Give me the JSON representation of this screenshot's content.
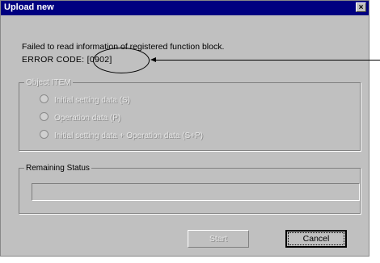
{
  "window": {
    "title": "Upload new",
    "close_glyph": "×"
  },
  "message": {
    "line1": "Failed to read information of registered function block.",
    "error_label": "ERROR CODE:",
    "error_code": "[0902]"
  },
  "object_group": {
    "legend": "Object ITEM",
    "options": [
      {
        "label": "Initial setting data (S)"
      },
      {
        "label": "Operation data (P)"
      },
      {
        "label": "Initial setting data + Operation data (S+P)"
      }
    ]
  },
  "status_group": {
    "legend": "Remaining Status",
    "progress": 0
  },
  "buttons": {
    "start": "Start",
    "cancel": "Cancel"
  }
}
